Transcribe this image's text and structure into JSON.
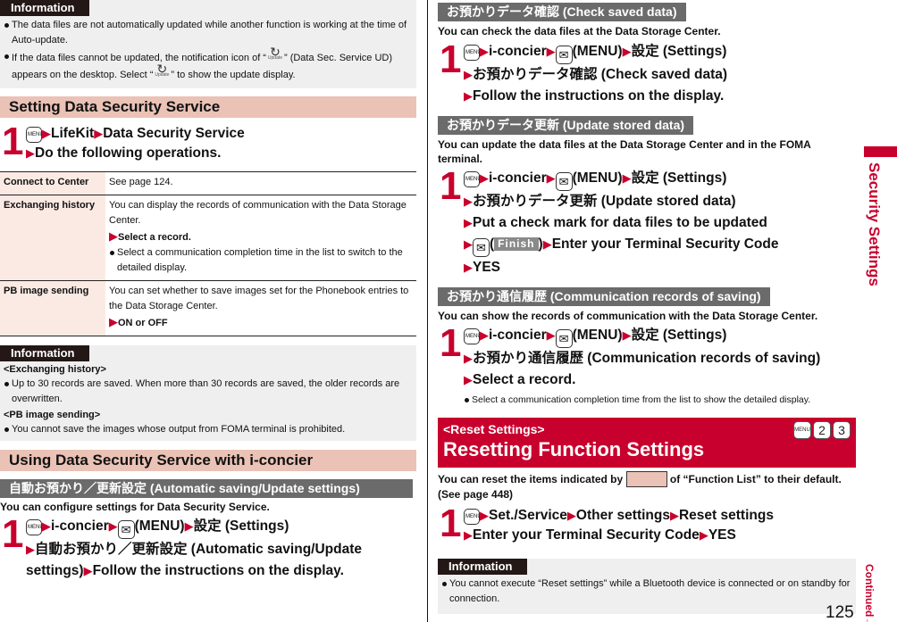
{
  "left": {
    "info1": {
      "tag": "Information",
      "bullets": [
        "The data files are not automatically updated while another function is working at the time of Auto-update.",
        {
          "pre": "If the data files cannot be updated, the notification icon of “",
          "mid": "” (Data Sec. Service UD) appears on the desktop. Select “",
          "post": "” to show the update display."
        }
      ],
      "update_icon_label": "Update"
    },
    "section1": {
      "title": "Setting Data Security Service",
      "step": {
        "num": "1",
        "line1": [
          "LifeKit",
          "Data Security Service"
        ],
        "line2": "Do the following operations."
      },
      "table": [
        {
          "label": "Connect to Center",
          "text": "See page 124."
        },
        {
          "label": "Exchanging history",
          "text": "You can display the records of communication with the Data Storage Center.",
          "step": "Select a record.",
          "bullet": "Select a communication completion time in the list to switch to the detailed display."
        },
        {
          "label": "PB image sending",
          "text": "You can set whether to save images set for the Phonebook entries to the Data Storage Center.",
          "step": "ON or OFF"
        }
      ]
    },
    "info2": {
      "tag": "Information",
      "groups": [
        {
          "sub": "<Exchanging history>",
          "bullet": "Up to 30 records are saved. When more than 30 records are saved, the older records are overwritten."
        },
        {
          "sub": "<PB image sending>",
          "bullet": "You cannot save the images whose output from FOMA terminal is prohibited."
        }
      ]
    },
    "section2": {
      "title": "Using Data Security Service with i-concier",
      "subhead": "自動お預かり／更新設定 (Automatic saving/Update settings)",
      "desc": "You can configure settings for Data Security Service.",
      "step": {
        "num": "1",
        "line1": [
          "i-concier",
          "(MENU)",
          "設定 (Settings)"
        ],
        "line2": "自動お預かり／更新設定 (Automatic saving/Update",
        "line3a": "settings)",
        "line3b": "Follow the instructions on the display."
      }
    }
  },
  "right": {
    "check": {
      "subhead": "お預かりデータ確認 (Check saved data)",
      "desc": "You can check the data files at the Data Storage Center.",
      "step": {
        "num": "1",
        "line1": [
          "i-concier",
          "(MENU)",
          "設定 (Settings)"
        ],
        "line2": "お預かりデータ確認 (Check saved data)",
        "line3": "Follow the instructions on the display."
      }
    },
    "update": {
      "subhead": "お預かりデータ更新 (Update stored data)",
      "desc": "You can update the data files at the Data Storage Center and in the FOMA terminal.",
      "step": {
        "num": "1",
        "line1": [
          "i-concier",
          "(MENU)",
          "設定 (Settings)"
        ],
        "line2": "お預かりデータ更新 (Update stored data)",
        "line3": "Put a check mark for data files to be updated",
        "finish_key": "Finish",
        "line4": "Enter your Terminal Security Code",
        "line5": "YES"
      }
    },
    "records": {
      "subhead": "お預かり通信履歴 (Communication records of saving)",
      "desc": "You can show the records of communication with the Data Storage Center.",
      "step": {
        "num": "1",
        "line1": [
          "i-concier",
          "(MENU)",
          "設定 (Settings)"
        ],
        "line2": "お預かり通信履歴 (Communication records of saving)",
        "line3": "Select a record.",
        "bullet": "Select a communication completion time from the list to show the detailed display."
      }
    },
    "reset": {
      "sub": "<Reset Settings>",
      "title": "Resetting Function Settings",
      "shortcut": [
        "MENU",
        "2",
        "3"
      ],
      "desc_pre": "You can reset the items indicated by",
      "desc_post": "of “Function List” to their default. (See page 448)",
      "swatch_color": "#eac2b6",
      "step": {
        "num": "1",
        "line1": [
          "Set./Service",
          "Other settings",
          "Reset settings"
        ],
        "line2": [
          "Enter your Terminal Security Code",
          "YES"
        ]
      }
    },
    "info": {
      "tag": "Information",
      "bullet": "You cannot execute “Reset settings” while a Bluetooth device is connected or on standby for connection."
    }
  },
  "sidebar": {
    "label": "Security Settings",
    "continued": "Continued→",
    "accent": "#c8002d"
  },
  "page_number": "125",
  "keys": {
    "menu": "MENU",
    "mail_glyph": "✉",
    "triangle": "▶"
  }
}
